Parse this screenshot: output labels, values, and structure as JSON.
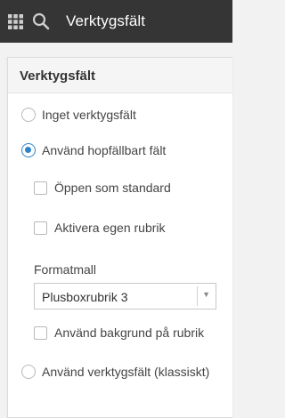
{
  "header": {
    "title": "Verktygsfält",
    "apps_icon": "apps-grid-icon",
    "search_icon": "search-icon"
  },
  "panel": {
    "title": "Verktygsfält",
    "options": {
      "none": {
        "label": "Inget verktygsfält",
        "checked": false
      },
      "collapsible": {
        "label": "Använd hopfällbart fält",
        "checked": true
      },
      "open_default": {
        "label": "Öppen som standard",
        "checked": false
      },
      "own_heading": {
        "label": "Aktivera egen rubrik",
        "checked": false
      },
      "bg_heading": {
        "label": "Använd bakgrund på rubrik",
        "checked": false
      },
      "classic": {
        "label": "Använd verktygsfält (klassiskt)",
        "checked": false
      }
    },
    "format": {
      "label": "Formatmall",
      "selected": "Plusboxrubrik 3"
    }
  },
  "colors": {
    "topbar": "#353535",
    "accent": "#2f82c9"
  }
}
